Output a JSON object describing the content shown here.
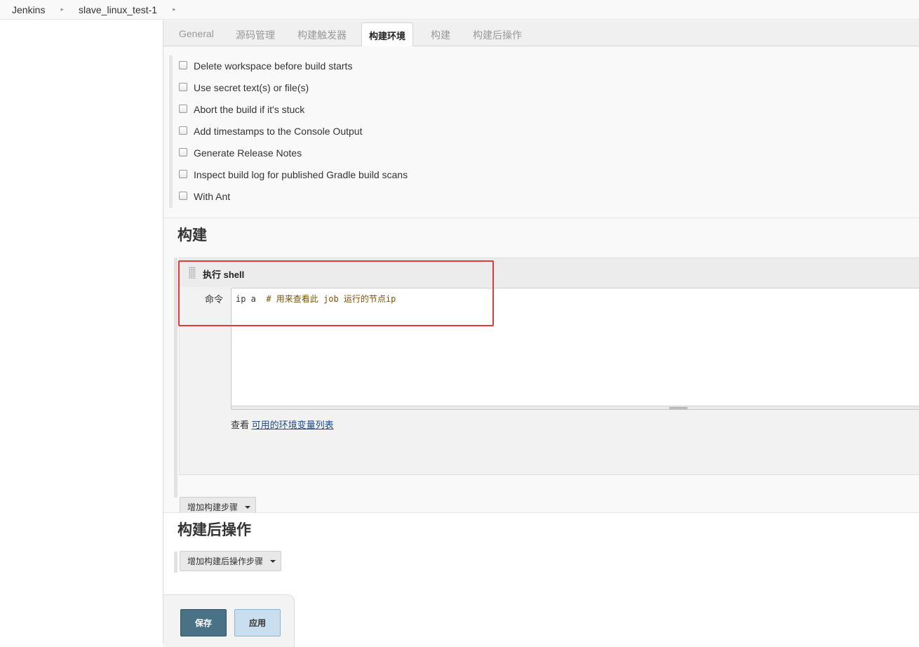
{
  "breadcrumb": {
    "items": [
      {
        "label": "Jenkins"
      },
      {
        "label": "slave_linux_test-1"
      }
    ]
  },
  "tabs": [
    {
      "label": "General"
    },
    {
      "label": "源码管理"
    },
    {
      "label": "构建触发器"
    },
    {
      "label": "构建环境",
      "active": true
    },
    {
      "label": "构建"
    },
    {
      "label": "构建后操作"
    }
  ],
  "build_env": {
    "options": [
      {
        "label": "Delete workspace before build starts",
        "checked": false
      },
      {
        "label": "Use secret text(s) or file(s)",
        "checked": false
      },
      {
        "label": "Abort the build if it's stuck",
        "checked": false
      },
      {
        "label": "Add timestamps to the Console Output",
        "checked": false
      },
      {
        "label": "Generate Release Notes",
        "checked": false
      },
      {
        "label": "Inspect build log for published Gradle build scans",
        "checked": false
      },
      {
        "label": "With Ant",
        "checked": false
      }
    ]
  },
  "build": {
    "title": "构建",
    "step": {
      "title": "执行 shell",
      "command_label": "命令",
      "command_code": "ip a",
      "command_comment": "# 用来查看此 job 运行的节点ip",
      "help_prefix": "查看",
      "help_link": "可用的环境变量列表"
    },
    "add_step_label": "增加构建步骤"
  },
  "post_build": {
    "title": "构建后操作",
    "add_step_label": "增加构建后操作步骤"
  },
  "actions": {
    "save_label": "保存",
    "apply_label": "应用"
  },
  "colors": {
    "highlight_frame": "#e53935",
    "save_button": "#4a7286",
    "apply_button": "#c9dff0",
    "link": "#204a87"
  }
}
